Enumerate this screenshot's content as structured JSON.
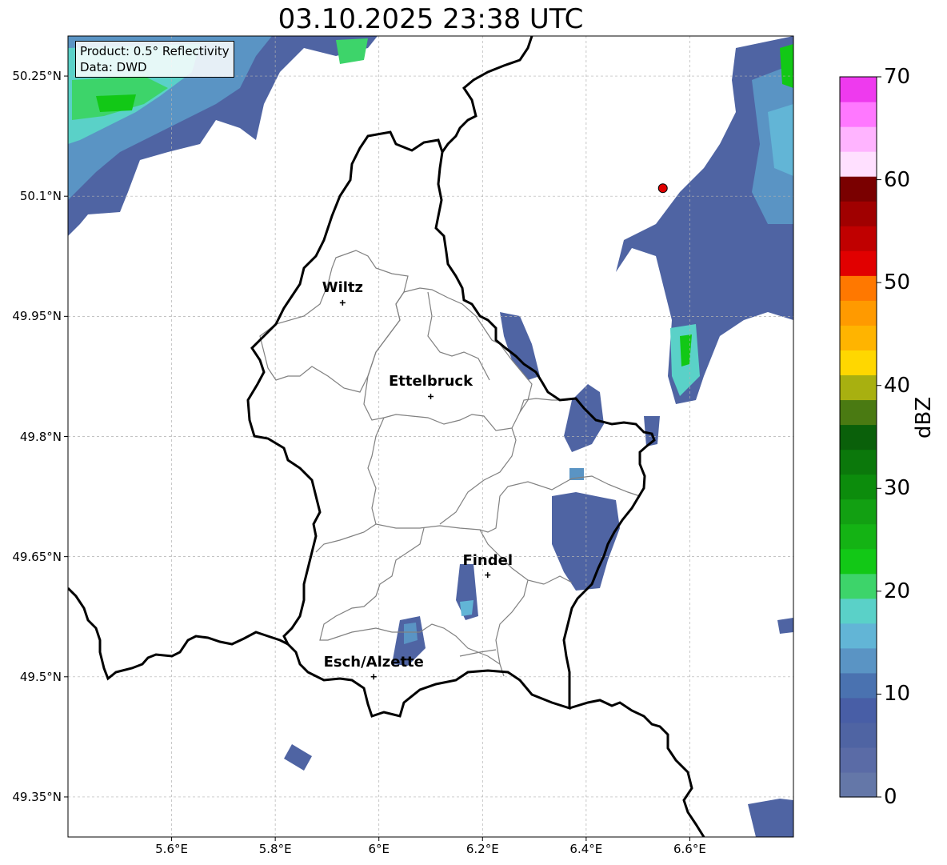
{
  "title": "03.10.2025 23:38 UTC",
  "info": {
    "product": "Product: 0.5° Reflectivity",
    "data": "Data: DWD"
  },
  "axes": {
    "lon_range": [
      5.4,
      6.8
    ],
    "lat_range": [
      49.3,
      50.3
    ],
    "lat_ticks": [
      {
        "value": 50.25,
        "label": "50.25°N"
      },
      {
        "value": 50.1,
        "label": "50.1°N"
      },
      {
        "value": 49.95,
        "label": "49.95°N"
      },
      {
        "value": 49.8,
        "label": "49.8°N"
      },
      {
        "value": 49.65,
        "label": "49.65°N"
      },
      {
        "value": 49.5,
        "label": "49.5°N"
      },
      {
        "value": 49.35,
        "label": "49.35°N"
      }
    ],
    "lon_ticks": [
      {
        "value": 5.6,
        "label": "5.6°E"
      },
      {
        "value": 5.8,
        "label": "5.8°E"
      },
      {
        "value": 6.0,
        "label": "6°E"
      },
      {
        "value": 6.2,
        "label": "6.2°E"
      },
      {
        "value": 6.4,
        "label": "6.4°E"
      },
      {
        "value": 6.6,
        "label": "6.6°E"
      }
    ],
    "grid": true
  },
  "cities": [
    {
      "name": "Wiltz",
      "lon": 5.93,
      "lat": 49.967
    },
    {
      "name": "Ettelbruck",
      "lon": 6.1,
      "lat": 49.85
    },
    {
      "name": "Findel",
      "lon": 6.21,
      "lat": 49.627
    },
    {
      "name": "Esch/Alzette",
      "lon": 5.99,
      "lat": 49.5
    }
  ],
  "radar_site": {
    "lon": 6.548,
    "lat": 50.11,
    "color": "#e00000"
  },
  "colorbar": {
    "title": "dBZ",
    "min": 0,
    "max": 70,
    "tick_labels": [
      "0",
      "10",
      "20",
      "30",
      "40",
      "50",
      "60",
      "70"
    ],
    "colors": [
      "#6477a8",
      "#5a6ba6",
      "#4f64a3",
      "#485ea6",
      "#4a72b0",
      "#5a94c4",
      "#62b5d6",
      "#5ad1c8",
      "#3dd46a",
      "#12c816",
      "#14b314",
      "#12a012",
      "#0c8c0c",
      "#0b780b",
      "#0a600a",
      "#4a7a12",
      "#a8b010",
      "#ffd700",
      "#ffb400",
      "#ff9a00",
      "#ff7800",
      "#e10000",
      "#c00000",
      "#a00000",
      "#7a0000",
      "#ffe0ff",
      "#ffb4ff",
      "#ff78ff",
      "#ee3aee"
    ]
  }
}
